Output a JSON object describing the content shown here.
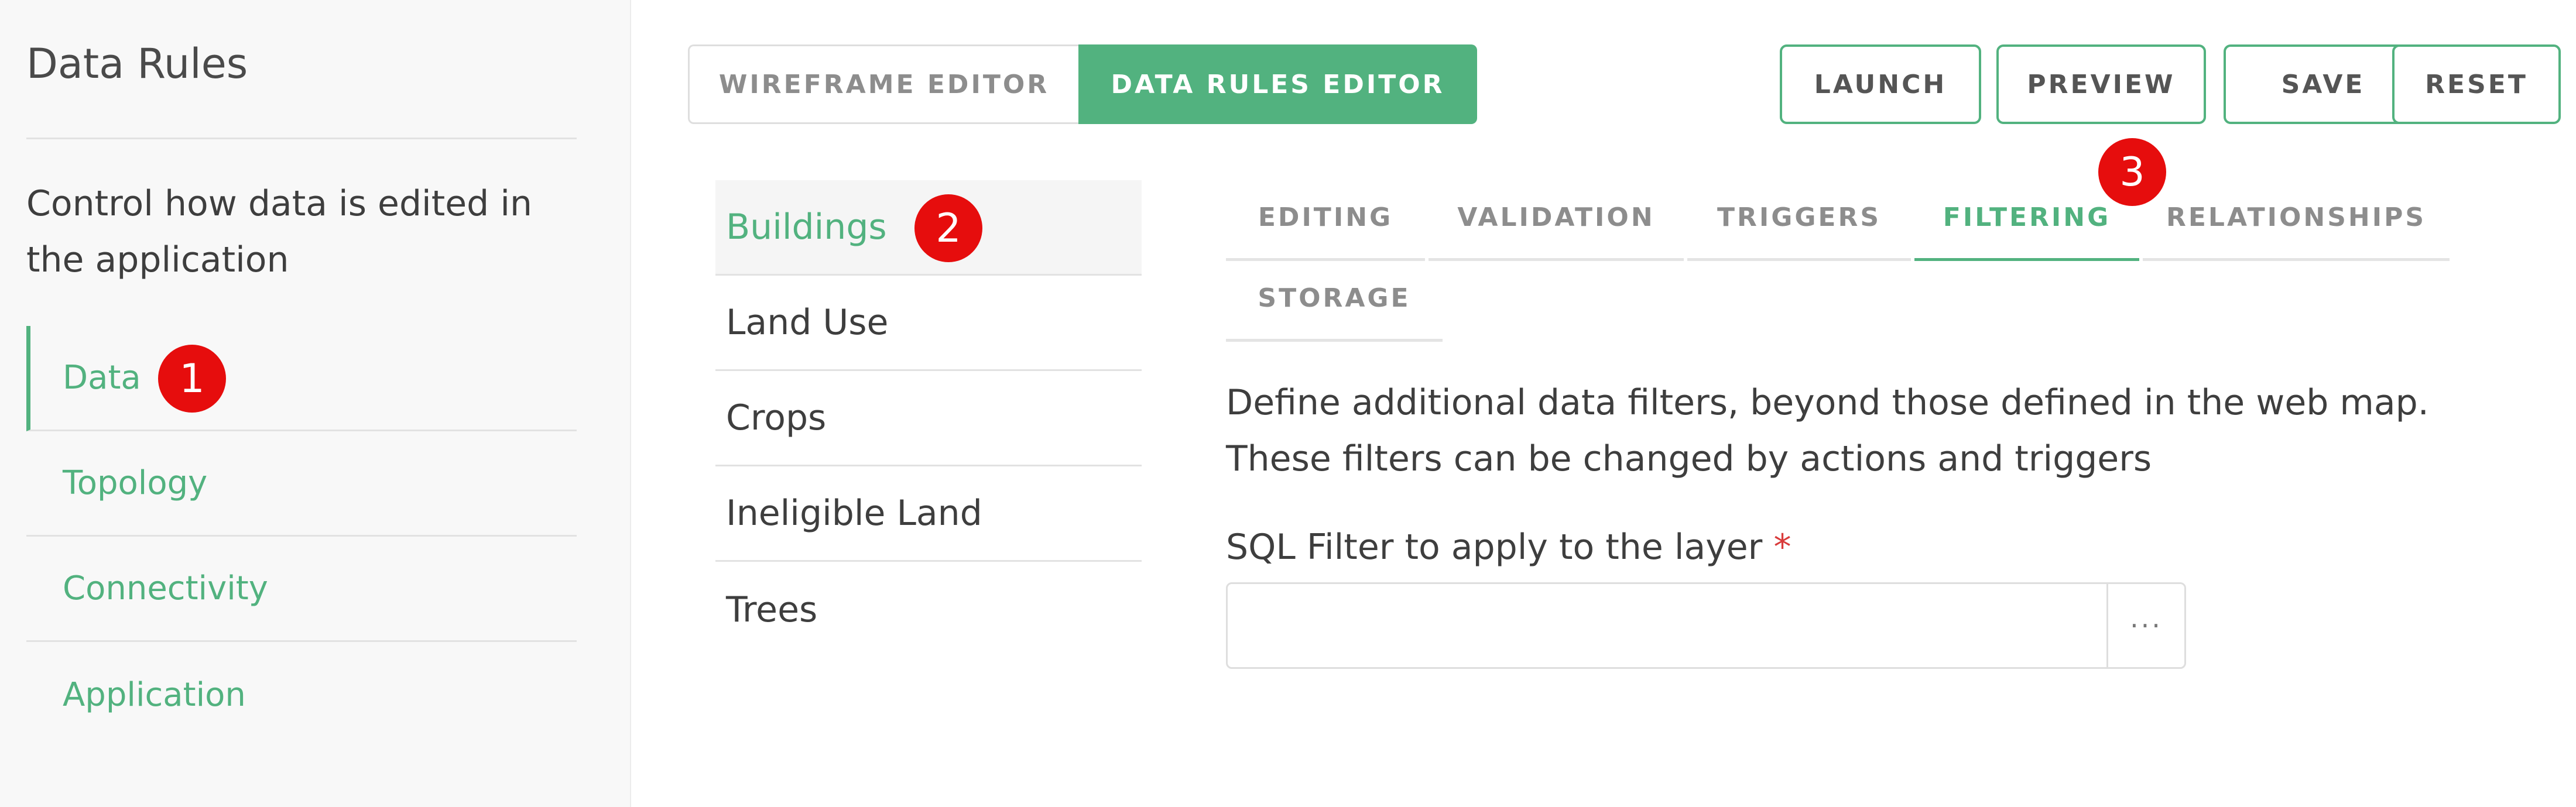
{
  "sidebar": {
    "title": "Data Rules",
    "description": "Control how data is edited in the application",
    "items": [
      {
        "label": "Data"
      },
      {
        "label": "Topology"
      },
      {
        "label": "Connectivity"
      },
      {
        "label": "Application"
      }
    ]
  },
  "toolbar": {
    "wireframe_editor": "WIREFRAME EDITOR",
    "data_rules_editor": "DATA RULES EDITOR",
    "launch": "LAUNCH",
    "preview": "PREVIEW",
    "save": "SAVE",
    "reset": "RESET"
  },
  "layers": [
    {
      "label": "Buildings"
    },
    {
      "label": "Land Use"
    },
    {
      "label": "Crops"
    },
    {
      "label": "Ineligible Land"
    },
    {
      "label": "Trees"
    }
  ],
  "tabs": {
    "editing": "EDITING",
    "validation": "VALIDATION",
    "triggers": "TRIGGERS",
    "filtering": "FILTERING",
    "relationships": "RELATIONSHIPS",
    "storage": "STORAGE"
  },
  "filtering": {
    "description": "Define additional data filters, beyond those defined in the web map. These filters can be changed by actions and triggers",
    "sql_label": "SQL Filter to apply to the layer",
    "required_mark": "*",
    "sql_value": "",
    "browse_button": "···"
  },
  "markers": [
    "1",
    "2",
    "3"
  ],
  "colors": {
    "accent": "#52b27f",
    "marker": "#e60d0d"
  }
}
